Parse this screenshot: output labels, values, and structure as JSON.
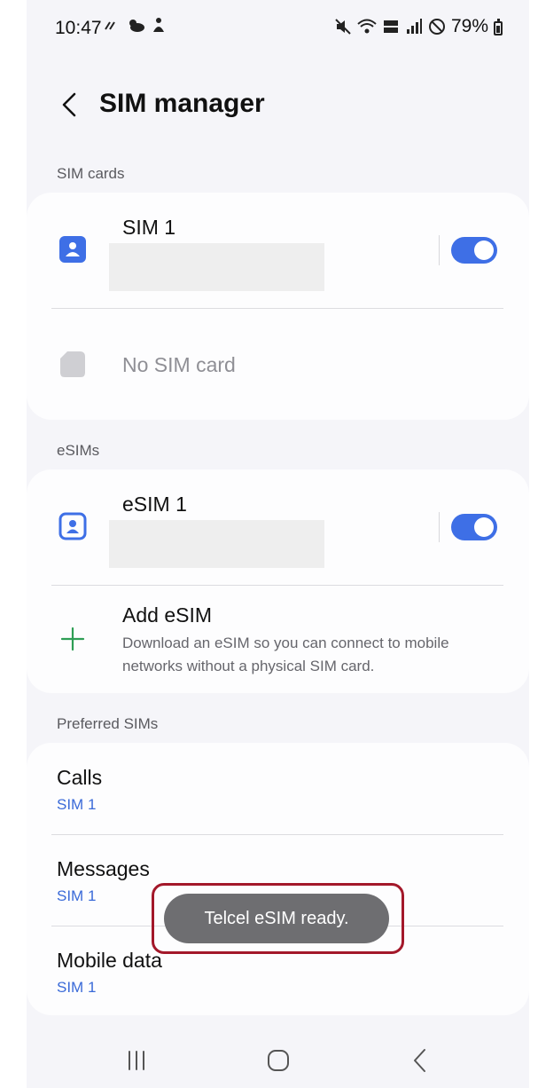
{
  "status_bar": {
    "time": "10:47",
    "battery": "79%"
  },
  "header": {
    "title": "SIM manager"
  },
  "sections": {
    "sim_cards": "SIM cards",
    "esims": "eSIMs",
    "preferred": "Preferred SIMs"
  },
  "sim_cards": {
    "sim1": {
      "label": "SIM 1",
      "enabled": true
    },
    "empty_slot": {
      "label": "No SIM card"
    }
  },
  "esims": {
    "esim1": {
      "label": "eSIM 1",
      "enabled": true
    },
    "add": {
      "title": "Add eSIM",
      "subtitle": "Download an eSIM so you can connect to mobile networks without a physical SIM card."
    }
  },
  "preferred": {
    "calls": {
      "label": "Calls",
      "value": "SIM 1"
    },
    "messages": {
      "label": "Messages",
      "value": "SIM 1"
    },
    "mobile_data": {
      "label": "Mobile data",
      "value": "SIM 1"
    }
  },
  "toast": {
    "message": "Telcel eSIM ready."
  },
  "colors": {
    "accent": "#3e6fe6",
    "background": "#f5f5f9",
    "card": "#fdfdfe",
    "highlight": "#a3182a",
    "add_icon": "#2e9e55"
  },
  "icons": {
    "back": "chevron-left-icon",
    "sim": "sim-card-icon",
    "esim": "esim-icon",
    "add": "plus-icon",
    "nav_recents": "recents-icon",
    "nav_home": "home-icon",
    "nav_back": "back-icon"
  }
}
